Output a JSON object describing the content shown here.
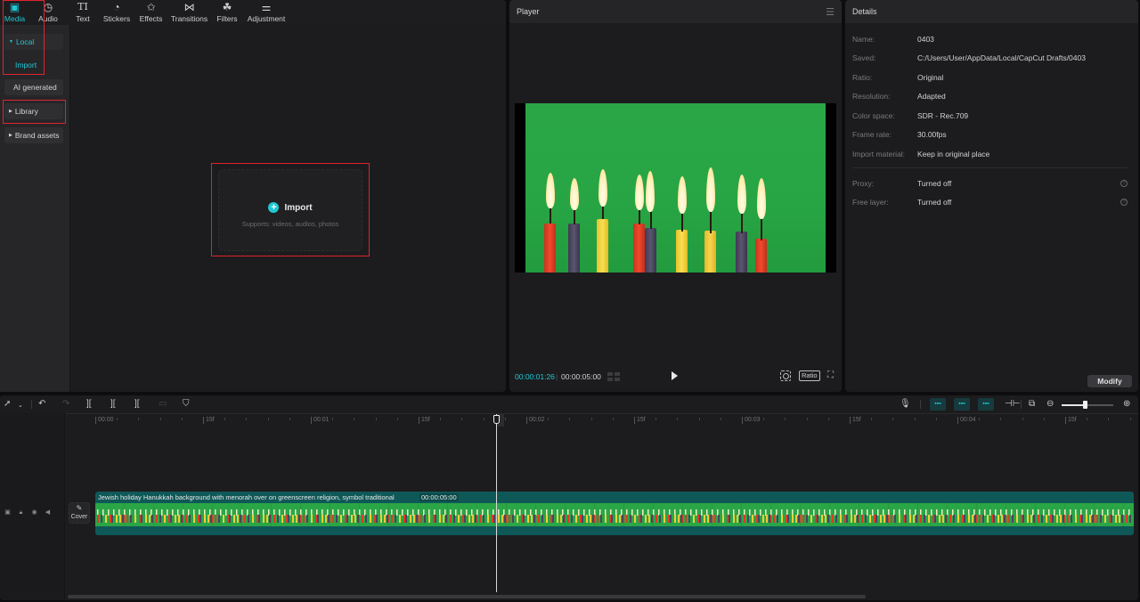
{
  "media_tabs": [
    {
      "label": "Media",
      "icon": "media-icon",
      "glyph": "▣",
      "active": true
    },
    {
      "label": "Audio",
      "icon": "audio-icon",
      "glyph": "◷"
    },
    {
      "label": "Text",
      "icon": "text-icon",
      "glyph": "TI"
    },
    {
      "label": "Stickers",
      "icon": "stickers-icon",
      "glyph": "◔"
    },
    {
      "label": "Effects",
      "icon": "effects-icon",
      "glyph": "✩"
    },
    {
      "label": "Transitions",
      "icon": "transitions-icon",
      "glyph": "⋈"
    },
    {
      "label": "Filters",
      "icon": "filters-icon",
      "glyph": "☘"
    },
    {
      "label": "Adjustment",
      "icon": "adjustment-icon",
      "glyph": "⚌"
    }
  ],
  "sidebar": {
    "local": "Local",
    "import": "Import",
    "ai_generated": "AI generated",
    "library": "Library",
    "brand_assets": "Brand assets"
  },
  "import_box": {
    "label": "Import",
    "hint": "Supports: videos, audios, photos"
  },
  "player": {
    "title": "Player",
    "current_time": "00:00:01:26",
    "total_time": "00:00:05:00",
    "ratio_label": "Ratio"
  },
  "details": {
    "title": "Details",
    "rows": [
      {
        "label": "Name:",
        "value": "0403"
      },
      {
        "label": "Saved:",
        "value": "C:/Users/User/AppData/Local/CapCut Drafts/0403"
      },
      {
        "label": "Ratio:",
        "value": "Original"
      },
      {
        "label": "Resolution:",
        "value": "Adapted"
      },
      {
        "label": "Color space:",
        "value": "SDR - Rec.709"
      },
      {
        "label": "Frame rate:",
        "value": "30.00fps"
      },
      {
        "label": "Import material:",
        "value": "Keep in original place"
      }
    ],
    "extra_rows": [
      {
        "label": "Proxy:",
        "value": "Turned off"
      },
      {
        "label": "Free layer:",
        "value": "Turned off"
      }
    ],
    "modify_label": "Modify"
  },
  "timeline": {
    "ruler_labels": [
      "00:00",
      "15f",
      "00:01",
      "15f",
      "00:02",
      "15f",
      "00:03",
      "15f",
      "00:04",
      "15f"
    ],
    "cover_label": "Cover",
    "clip_title": "Jewish holiday Hanukkah background with menorah over on greenscreen religion, symbol traditional",
    "clip_duration": "00:00:05:00",
    "zoom_level": 0.45
  },
  "colors": {
    "accent": "#1fc8d3",
    "highlight_box": "#e0242d",
    "clip_track": "#0f5858",
    "greenscreen": "#2aa646"
  }
}
